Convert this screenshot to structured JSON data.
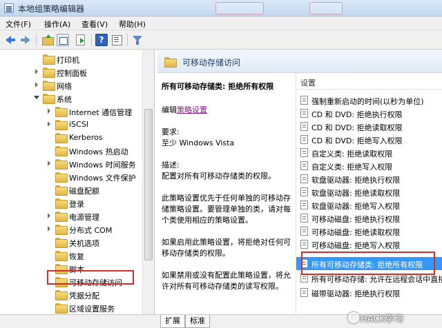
{
  "window": {
    "title": "本地组策略编辑器"
  },
  "menu": [
    {
      "label": "文件(F)"
    },
    {
      "label": "操作(A)"
    },
    {
      "label": "查看(V)"
    },
    {
      "label": "帮助(H)"
    }
  ],
  "toolbar": {
    "icons": [
      "back-arrow-icon",
      "forward-arrow-icon",
      "folder-up-icon",
      "show-hide-console-icon",
      "export-list-icon",
      "help-icon",
      "properties-icon",
      "filter-icon"
    ],
    "help_glyph": "?"
  },
  "tree": {
    "items": [
      {
        "label": "打印机"
      },
      {
        "label": "控制面板"
      },
      {
        "label": "网络"
      },
      {
        "label": "系统"
      },
      {
        "label": "Internet 通信管理"
      },
      {
        "label": "iSCSI"
      },
      {
        "label": "Kerberos"
      },
      {
        "label": "Windows 热启动"
      },
      {
        "label": "Windows 时间服务"
      },
      {
        "label": "Windows 文件保护"
      },
      {
        "label": "磁盘配额"
      },
      {
        "label": "登录"
      },
      {
        "label": "电源管理"
      },
      {
        "label": "分布式 COM"
      },
      {
        "label": "关机选项"
      },
      {
        "label": "恢复"
      },
      {
        "label": "脚本"
      },
      {
        "label": "可移动存储访问"
      },
      {
        "label": "凭据分配"
      },
      {
        "label": "区域设置服务"
      }
    ]
  },
  "right_header": {
    "title": "可移动存储访问"
  },
  "description": {
    "title": "所有可移动存储类: 拒绝所有权限",
    "edit_prefix": "编辑",
    "edit_link": "策略设置",
    "requirements_label": "要求:",
    "requirements_value": "至少 Windows Vista",
    "desc_label": "描述:",
    "desc_text": "配置对所有可移动存储类的权限。",
    "para1": "此策略设置优先于任何单独的可移动存储策略设置。要管理单独的类，请对每个类使用相应的策略设置。",
    "para2": "如果启用此策略设置，将拒绝对任何可移动存储类的权限。",
    "para3": "如果禁用或没有配置此策略设置，将允许对所有可移动存储类的读写权限。"
  },
  "settings": {
    "column_header": "设置",
    "items": [
      {
        "label": "强制重新启动的时间(以秒为单位)"
      },
      {
        "label": "CD 和 DVD: 拒绝执行权限"
      },
      {
        "label": "CD 和 DVD: 拒绝读取权限"
      },
      {
        "label": "CD 和 DVD: 拒绝写入权限"
      },
      {
        "label": "自定义类: 拒绝读取权限"
      },
      {
        "label": "自定义类: 拒绝写入权限"
      },
      {
        "label": "软盘驱动器: 拒绝执行权限"
      },
      {
        "label": "软盘驱动器: 拒绝读取权限"
      },
      {
        "label": "软盘驱动器: 拒绝写入权限"
      },
      {
        "label": "可移动磁盘: 拒绝执行权限"
      },
      {
        "label": "可移动磁盘: 拒绝读取权限"
      },
      {
        "label": "可移动磁盘: 拒绝写入权限"
      },
      {
        "label": "所有可移动存储类: 拒绝所有权限"
      },
      {
        "label": "所有可移动存储: 允许在远程会话中直接"
      },
      {
        "label": "磁带驱动器: 拒绝执行权限"
      }
    ]
  },
  "tabs": [
    {
      "label": "扩展"
    },
    {
      "label": "标准"
    }
  ],
  "watermark": {
    "text": "HACK学习"
  },
  "colors": {
    "selection": "#3399ff",
    "highlight_box": "#d42a2a",
    "link": "#8b1a8b"
  }
}
